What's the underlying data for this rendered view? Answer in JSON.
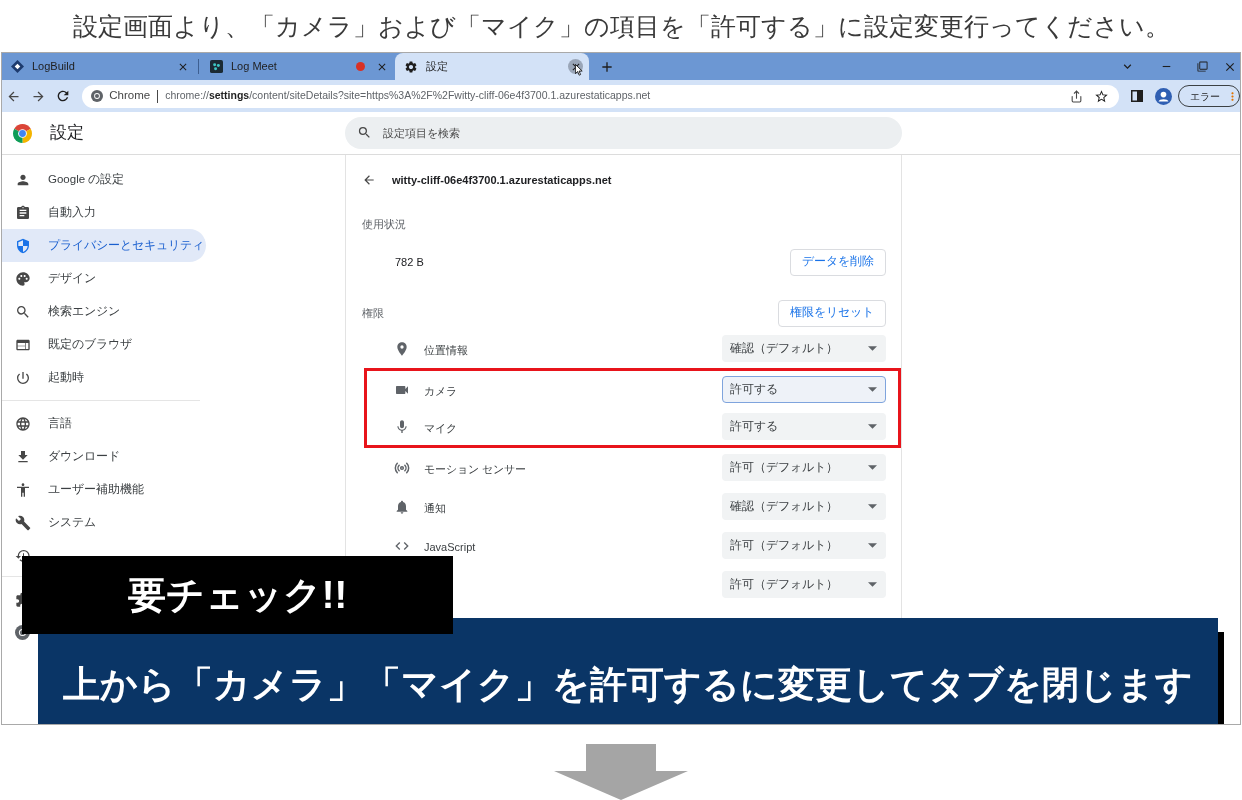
{
  "caption": "設定画面より、「カメラ」および「マイク」の項目を「許可する」に設定変更行ってください。",
  "browser": {
    "tabs": [
      {
        "title": "LogBuild",
        "selected": false,
        "recording": false,
        "close_hovered": false
      },
      {
        "title": "Log Meet",
        "selected": false,
        "recording": true,
        "close_hovered": false
      },
      {
        "title": "設定",
        "selected": true,
        "recording": false,
        "close_hovered": true
      }
    ],
    "address_bar": {
      "site_label": "Chrome",
      "url": "chrome://**settings**/content/siteDetails?site=https%3A%2F%2Fwitty-cliff-06e4f3700.1.azurestaticapps.net"
    },
    "profile_chip": "エラー"
  },
  "settings": {
    "title": "設定",
    "search": {
      "placeholder": "設定項目を検索"
    },
    "sidebar": {
      "groups": [
        [
          {
            "label": "Google の設定",
            "selected": false
          },
          {
            "label": "自動入力",
            "selected": false
          },
          {
            "label": "プライバシーとセキュリティ",
            "selected": true
          },
          {
            "label": "デザイン",
            "selected": false
          },
          {
            "label": "検索エンジン",
            "selected": false
          },
          {
            "label": "既定のブラウザ",
            "selected": false
          },
          {
            "label": "起動時",
            "selected": false
          }
        ],
        [
          {
            "label": "言語",
            "selected": false
          },
          {
            "label": "ダウンロード",
            "selected": false
          },
          {
            "label": "ユーザー補助機能",
            "selected": false
          },
          {
            "label": "システム",
            "selected": false
          }
        ]
      ]
    }
  },
  "site": {
    "title": "witty-cliff-06e4f3700.1.azurestaticapps.net",
    "usage": {
      "heading": "使用状況",
      "amount": "782 B",
      "clear_button": "データを削除"
    },
    "permissions": {
      "heading": "権限",
      "reset_button": "権限をリセット",
      "rows": [
        {
          "label": "位置情報",
          "value": "確認（デフォルト）",
          "focused": false,
          "highlighted": false
        },
        {
          "label": "カメラ",
          "value": "許可する",
          "focused": true,
          "highlighted": true
        },
        {
          "label": "マイク",
          "value": "許可する",
          "focused": false,
          "highlighted": true
        },
        {
          "label": "モーション センサー",
          "value": "許可（デフォルト）",
          "focused": false,
          "highlighted": false
        },
        {
          "label": "通知",
          "value": "確認（デフォルト）",
          "focused": false,
          "highlighted": false
        },
        {
          "label": "JavaScript",
          "value": "許可（デフォルト）",
          "focused": false,
          "highlighted": false
        },
        {
          "value": "許可（デフォルト）",
          "focused": false,
          "highlighted": false
        }
      ]
    }
  },
  "overlay": {
    "badge": "要チェック!!",
    "banner": "上から「カメラ」「マイク」を許可するに変更してタブを閉じます"
  }
}
